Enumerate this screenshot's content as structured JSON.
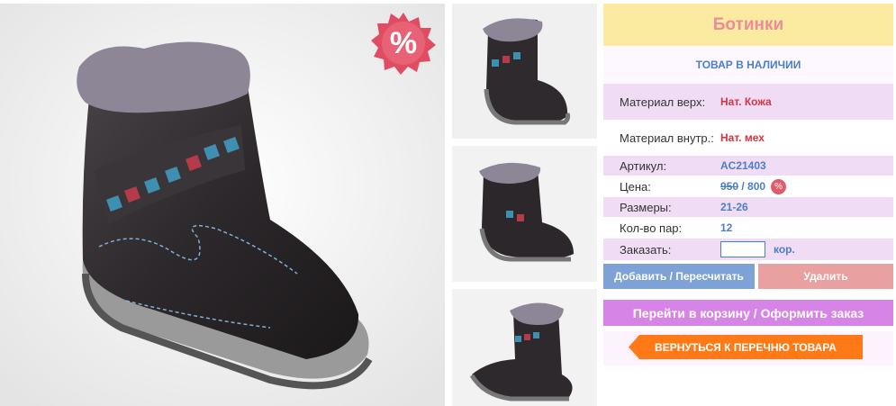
{
  "product": {
    "title": "Ботинки",
    "stock_status": "ТОВАР В НАЛИЧИИ",
    "sale_badge": "%"
  },
  "specs": [
    {
      "label": "Материал верх:",
      "value": "Нат. Кожа"
    },
    {
      "label": "Материал внутр.:",
      "value": "Нат. мех"
    },
    {
      "label": "Артикул:",
      "value": "AC21403"
    }
  ],
  "price": {
    "label": "Цена:",
    "old": "950",
    "separator": " / ",
    "new": "800",
    "badge": "%"
  },
  "sizes": {
    "label": "Размеры:",
    "value": "21-26"
  },
  "pairs": {
    "label": "Кол-во пар:",
    "value": "12"
  },
  "order": {
    "label": "Заказать:",
    "value": "",
    "unit": "кор."
  },
  "buttons": {
    "add": "Добавить / Пересчитать",
    "delete": "Удалить",
    "cart": "Перейти в корзину / Оформить заказ",
    "back": "ВЕРНУТЬСЯ К ПЕРЕЧНЮ ТОВАРА"
  },
  "colors": {
    "accent_blue": "#4a7fc8",
    "value_red": "#d4343f",
    "title_bg": "#fbeba0",
    "row_pink": "#f1dcf6",
    "cart_button": "#d784e7",
    "back_button": "#ff7a16"
  }
}
